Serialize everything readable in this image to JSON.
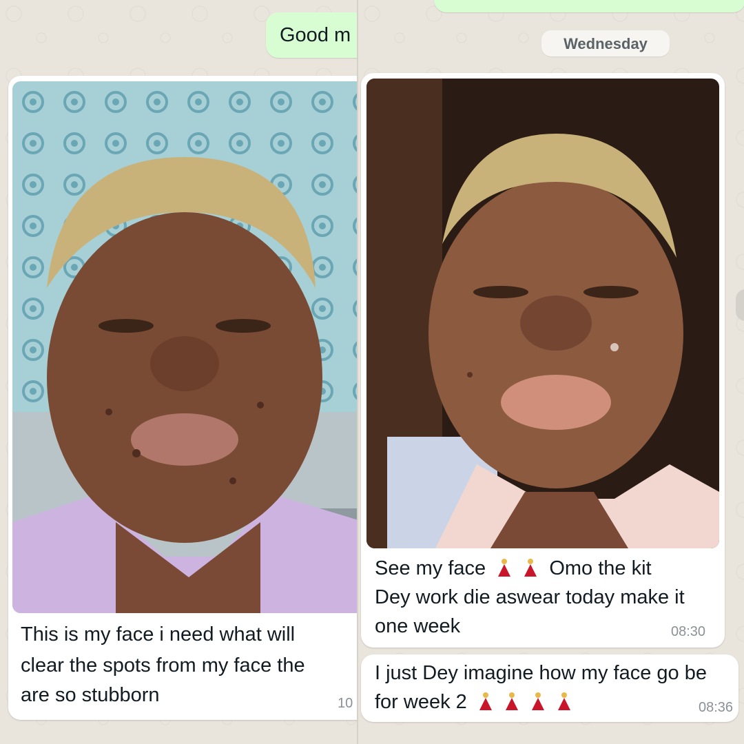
{
  "left": {
    "greeting_bubble": {
      "text": "Good m"
    },
    "message": {
      "lines": [
        "This is my face i need what will",
        "clear the spots from my face the",
        "are so stubborn"
      ],
      "time": "10"
    }
  },
  "right": {
    "date_chip": "Wednesday",
    "message1": {
      "line1_a": "See my face",
      "line1_b": "Omo the kit",
      "line2": "Dey work die aswear today make it",
      "line3": "one week",
      "time": "08:30"
    },
    "message2": {
      "line1": "I just Dey imagine how my face go be",
      "line2": "for week 2",
      "time": "08:36"
    }
  },
  "colors": {
    "outgoing_bubble": "#d9fdd3",
    "incoming_bubble": "#ffffff",
    "chat_background": "#e9e4dc",
    "timestamp": "#8a9297"
  },
  "icons": [
    "dancer-emoji"
  ]
}
